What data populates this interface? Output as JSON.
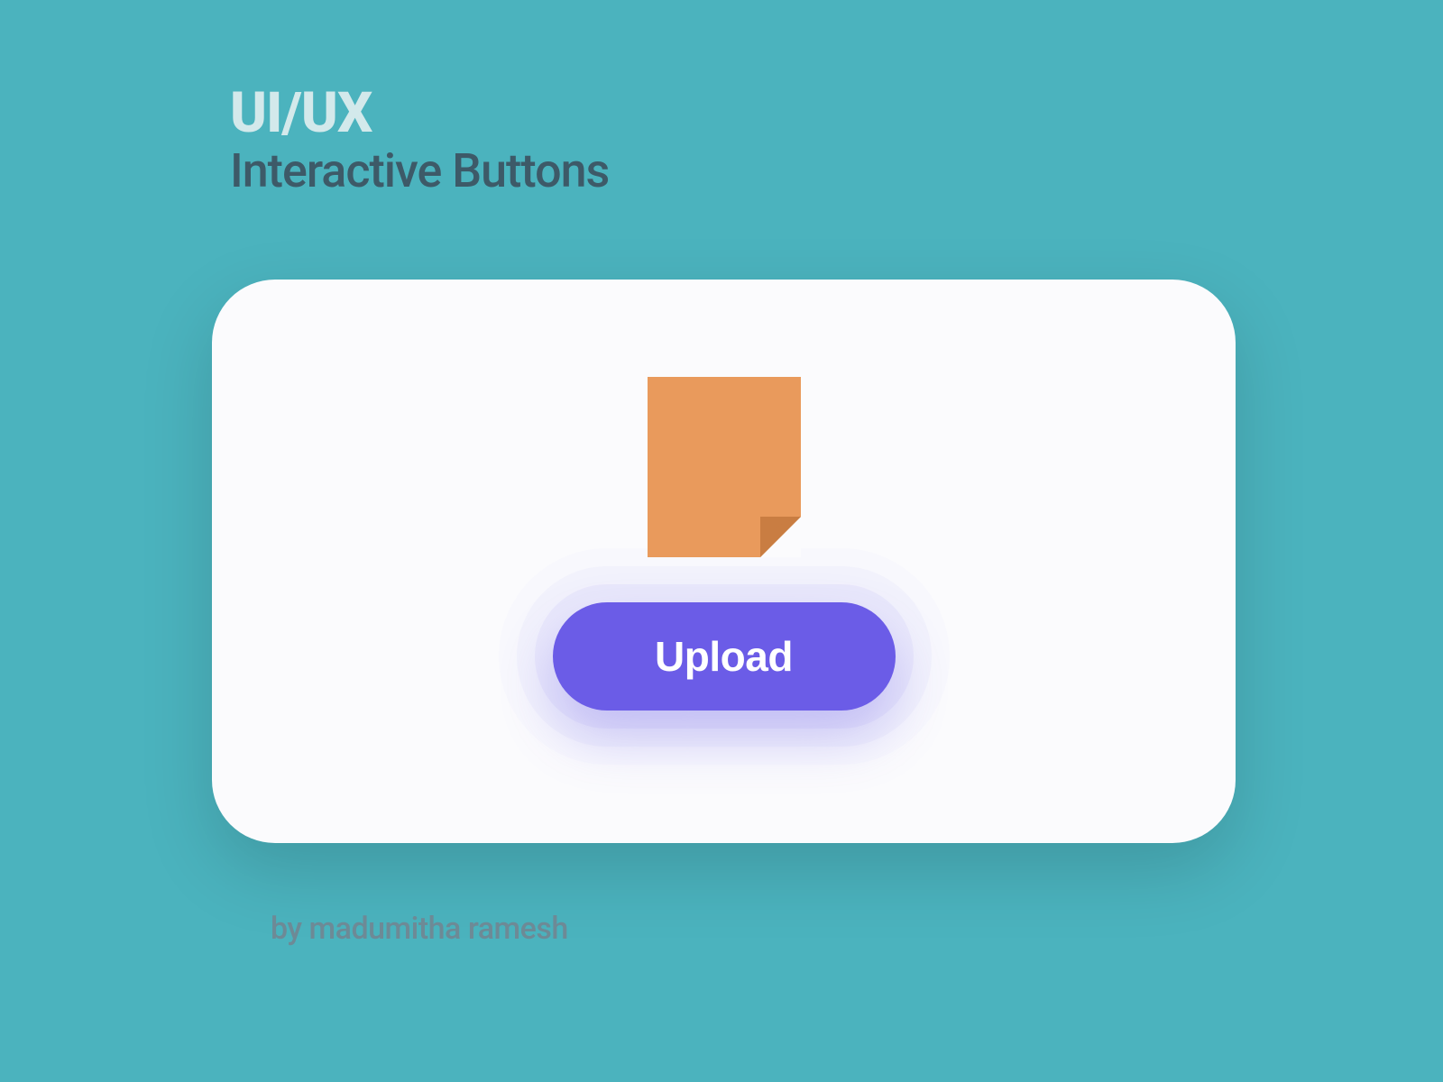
{
  "header": {
    "title": "UI/UX",
    "subtitle": "Interactive Buttons"
  },
  "card": {
    "button_label": "Upload"
  },
  "credit": "by madumitha ramesh",
  "colors": {
    "background": "#4bb3be",
    "card_bg": "#fbfbfd",
    "button_bg": "#6b5ce7",
    "document_fill": "#e99a5c",
    "document_fold": "#c97d42",
    "title_color": "#d3e9eb",
    "subtitle_color": "#3d5a68",
    "credit_color": "#6d8a96"
  }
}
